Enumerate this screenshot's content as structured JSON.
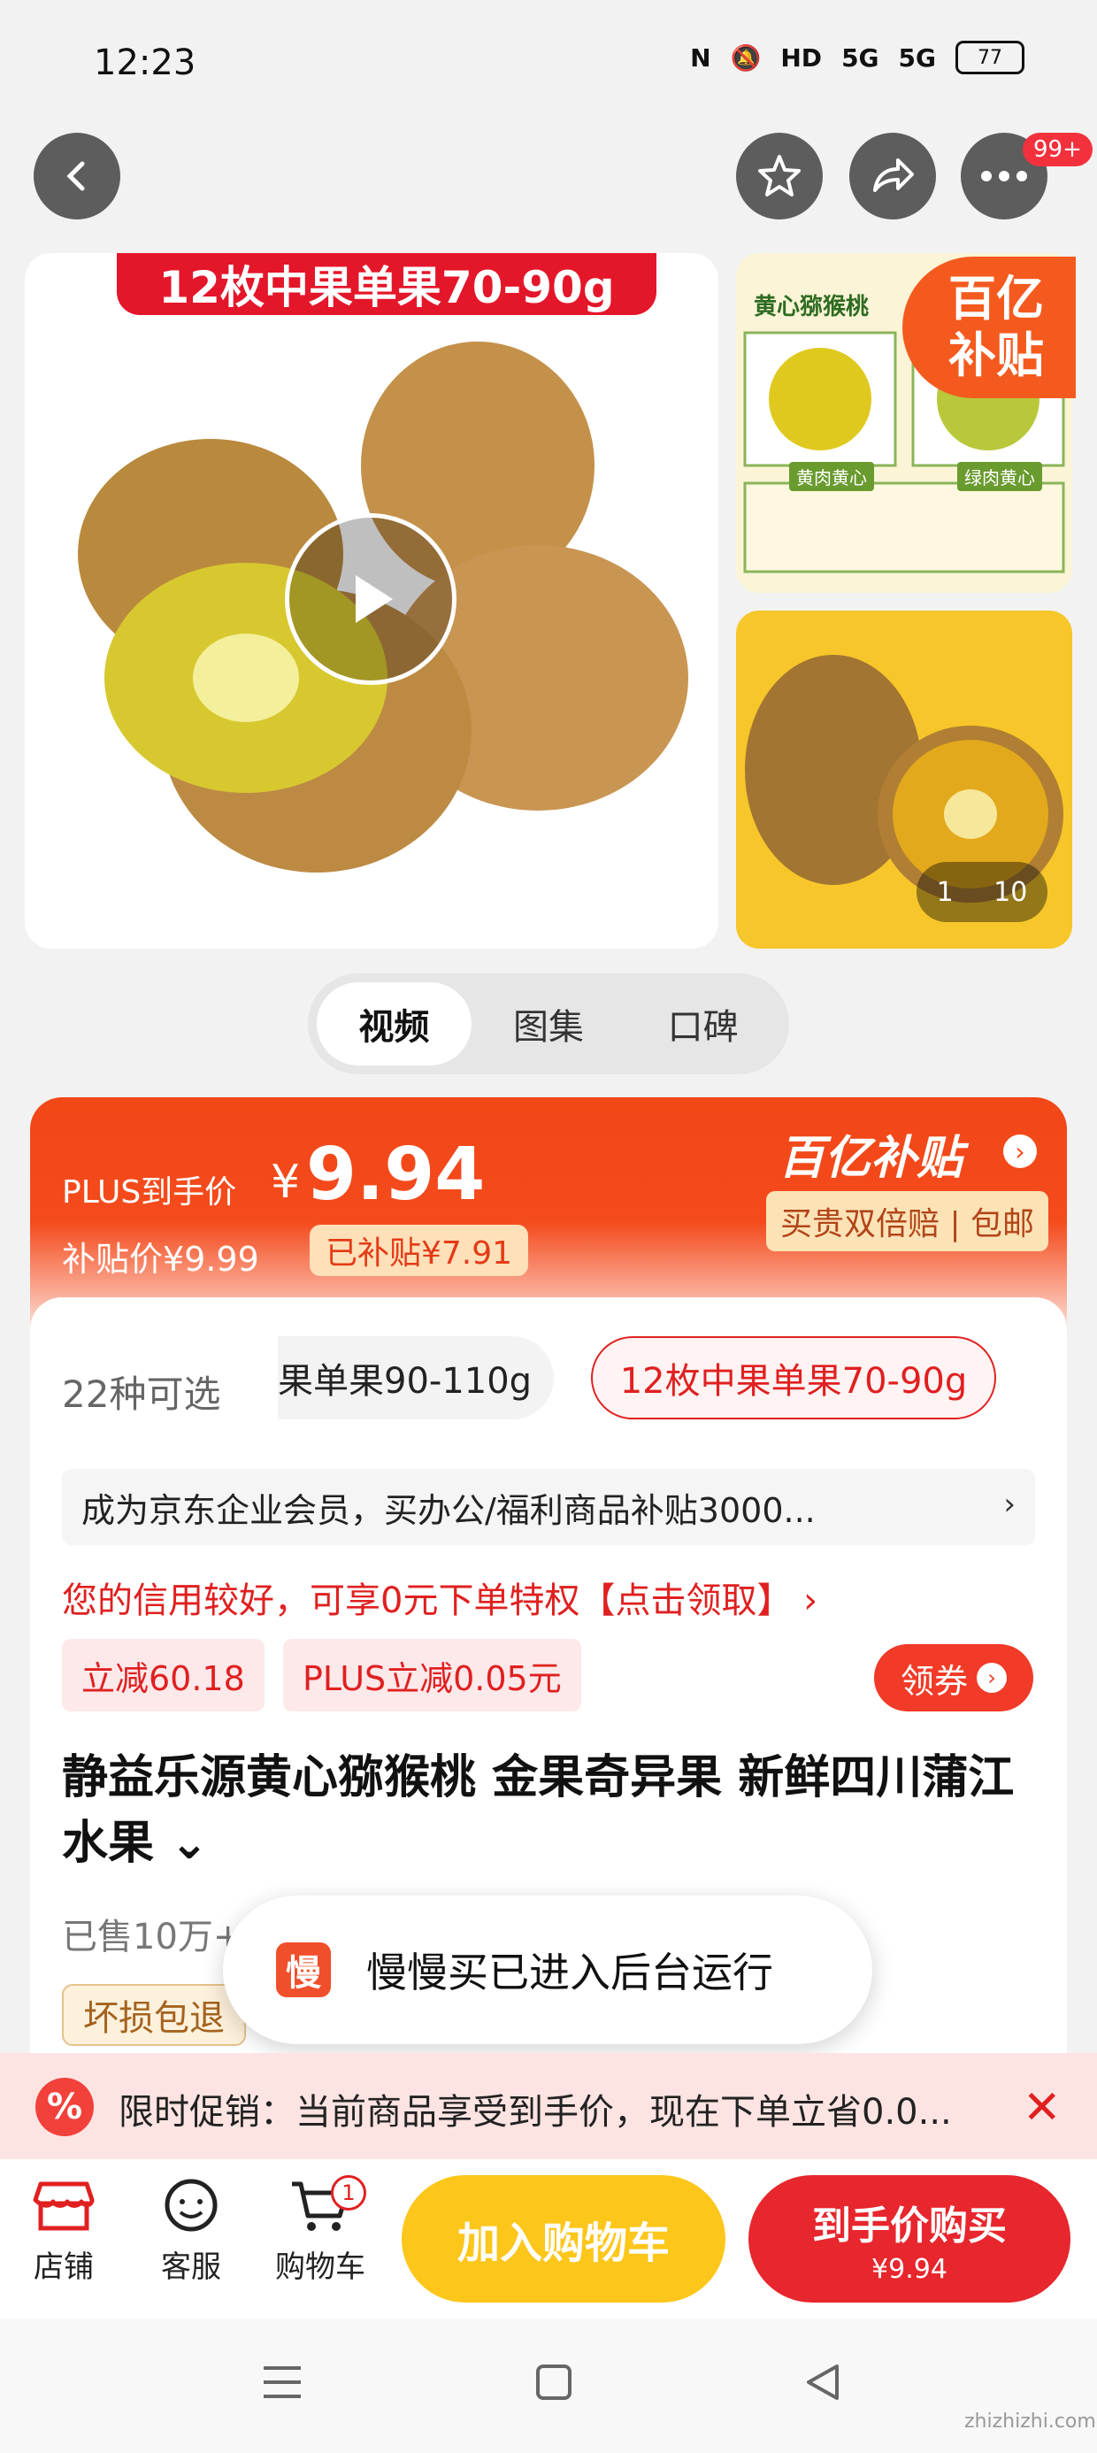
{
  "status_bar": {
    "time": "12:23",
    "battery": "77",
    "network": "5G"
  },
  "header": {
    "badge": "99+"
  },
  "gallery": {
    "main_banner": "12枚中果单果70-90g",
    "side_tag": "百亿补贴",
    "side_info": "黄心猕猴桃",
    "side_labels": [
      "黄肉黄心",
      "绿肉黄心"
    ],
    "pager_current": "1",
    "pager_total": "10"
  },
  "tabs": [
    {
      "label": "视频",
      "active": true
    },
    {
      "label": "图集",
      "active": false
    },
    {
      "label": "口碑",
      "active": false
    }
  ],
  "price": {
    "plus_label": "PLUS到手价",
    "currency": "¥",
    "plus_price": "9.94",
    "subsidy_label": "补贴价¥9.99",
    "subsidy_tag": "已补贴¥7.91",
    "yi_title": "百亿补贴",
    "yi_sub": "买贵双倍赔 | 包邮"
  },
  "options": {
    "count": "22种可选",
    "items": [
      {
        "label": "果单果90-110g",
        "selected": false
      },
      {
        "label": "12枚中果单果70-90g",
        "selected": true
      }
    ]
  },
  "promo_bar": "成为京东企业会员，买办公/福利商品补贴3000...",
  "credit": "您的信用较好，可享0元下单特权【点击领取】 ›",
  "coupons": [
    "立减60.18",
    "PLUS立减0.05元"
  ],
  "coupon_button": "领券",
  "product": {
    "title": "静益乐源黄心猕猴桃 金果奇异果 新鲜四川蒲江水果 ⌄",
    "sold": "已售10万+",
    "damage_tag": "坏损包退"
  },
  "toast": {
    "icon": "慢",
    "text": "慢慢买已进入后台运行"
  },
  "limit_promo": "限时促销：当前商品享受到手价，现在下单立省0.0...",
  "bottom_bar": {
    "shop": "店铺",
    "service": "客服",
    "cart": "购物车",
    "cart_count": "1",
    "add_cart": "加入购物车",
    "buy_now": "到手价购买",
    "buy_price": "¥9.94"
  },
  "watermark": "zhizhizhi.com",
  "colors": {
    "accent": "#e8262d",
    "orange": "#f24818",
    "yellow": "#fdc61a"
  }
}
